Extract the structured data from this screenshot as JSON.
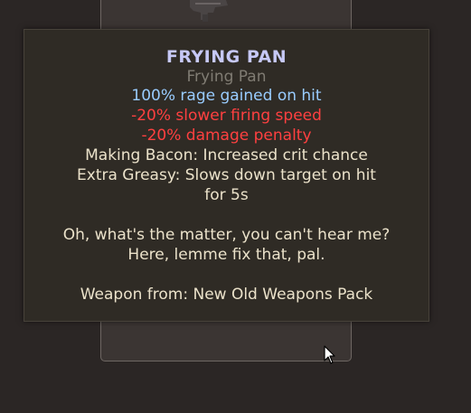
{
  "item": {
    "name": "FRYING PAN",
    "type": "Frying Pan",
    "attributes": [
      {
        "text": "100% rage gained on hit",
        "kind": "positive"
      },
      {
        "text": "-20% slower firing speed",
        "kind": "negative"
      },
      {
        "text": "-20% damage penalty",
        "kind": "negative"
      },
      {
        "text": "Making Bacon: Increased crit chance",
        "kind": "neutral"
      },
      {
        "text": "Extra Greasy: Slows down target on hit",
        "kind": "neutral"
      },
      {
        "text": "for 5s",
        "kind": "neutral"
      }
    ],
    "description": [
      "Oh, what's the matter, you can't hear me?",
      "Here, lemme fix that, pal."
    ],
    "source": "Weapon from: New Old Weapons Pack"
  },
  "colors": {
    "title": "#c6c8f6",
    "subtitle": "#807c73",
    "positive": "#99ccff",
    "negative": "#ff4040",
    "neutral": "#ebe2ca",
    "tooltip_bg": "#2f2b25",
    "panel_bg": "#3b3533",
    "page_bg": "#2b2625"
  },
  "icons": {
    "weapon": "weapon-image",
    "cursor": "mouse-cursor-icon"
  }
}
